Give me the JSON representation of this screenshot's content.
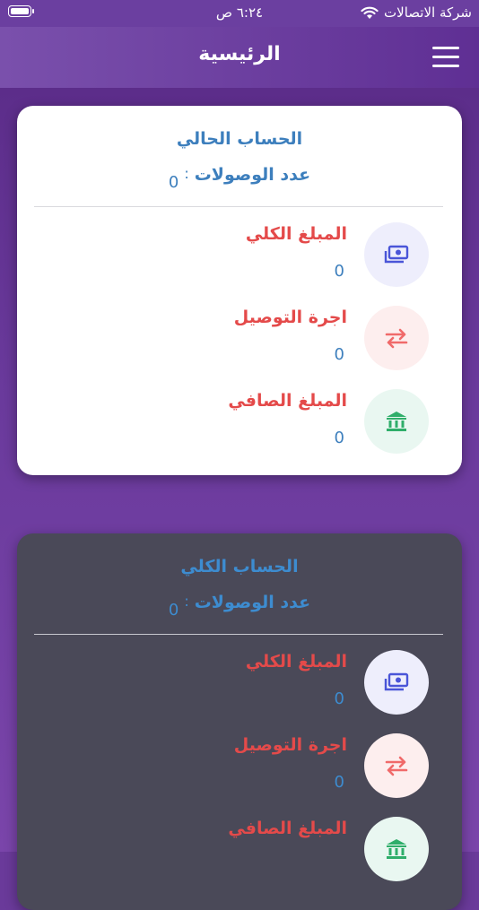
{
  "status_bar": {
    "time": "٦:٢٤ ص",
    "carrier": "شركة الاتصالات"
  },
  "header": {
    "title": "الرئيسية"
  },
  "current_account": {
    "title": "الحساب الحالي",
    "count_label": "عدد الوصولات",
    "count_separator": ":",
    "count_value": "0",
    "rows": [
      {
        "label": "المبلغ الكلي",
        "value": "0",
        "icon": "money-icon"
      },
      {
        "label": "اجرة التوصيل",
        "value": "0",
        "icon": "transfer-icon"
      },
      {
        "label": "المبلغ الصافي",
        "value": "0",
        "icon": "bank-icon"
      }
    ]
  },
  "total_account": {
    "title": "الحساب الكلي",
    "count_label": "عدد الوصولات",
    "count_separator": ":",
    "count_value": "0",
    "rows": [
      {
        "label": "المبلغ الكلي",
        "value": "0",
        "icon": "money-icon"
      },
      {
        "label": "اجرة التوصيل",
        "value": "0",
        "icon": "transfer-icon"
      },
      {
        "label": "المبلغ الصافي",
        "value": "",
        "icon": "bank-icon"
      }
    ]
  },
  "colors": {
    "header_bg": "#6b3fa0",
    "title_blue": "#3d7fbd",
    "label_red": "#e44a4a",
    "icon_blue": "#4a55d8",
    "icon_red": "#f06a6a",
    "icon_green": "#2fae6a",
    "dark_card": "#4a4958"
  }
}
